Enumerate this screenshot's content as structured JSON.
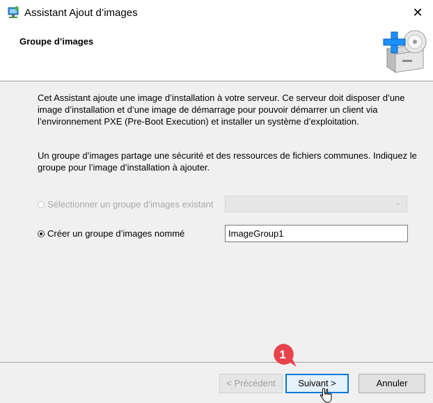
{
  "window": {
    "title": "Assistant Ajout d’images",
    "close_glyph": "✕",
    "app_icon": "network-computer-icon"
  },
  "header": {
    "title": "Groupe d’images",
    "graphic": "add-image-disc-icon"
  },
  "body": {
    "paragraph1": "Cet Assistant ajoute une image d’installation à votre serveur. Ce serveur doit disposer d’une image d’installation et d’une image de démarrage pour pouvoir démarrer un client via l’environnement PXE (Pre-Boot Execution) et installer un système d’exploitation.",
    "paragraph2": "Un groupe d’images partage une sécurité et des ressources de fichiers communes. Indiquez le groupe pour l’image d’installation à ajouter.",
    "option_existing": {
      "label": "Sélectionner un groupe d’images existant",
      "selected": false,
      "enabled": false,
      "dropdown_value": ""
    },
    "option_new": {
      "label": "Créer un groupe d’images nommé",
      "selected": true,
      "enabled": true,
      "value": "ImageGroup1"
    }
  },
  "footer": {
    "prev_label": "< Précédent",
    "next_label": "Suivant >",
    "cancel_label": "Annuler"
  },
  "annotation": {
    "step_number": "1",
    "color": "#e8424a"
  },
  "colors": {
    "accent": "#0078d7",
    "body_bg": "#f0f0f0",
    "disabled_text": "#a8a8a8"
  }
}
